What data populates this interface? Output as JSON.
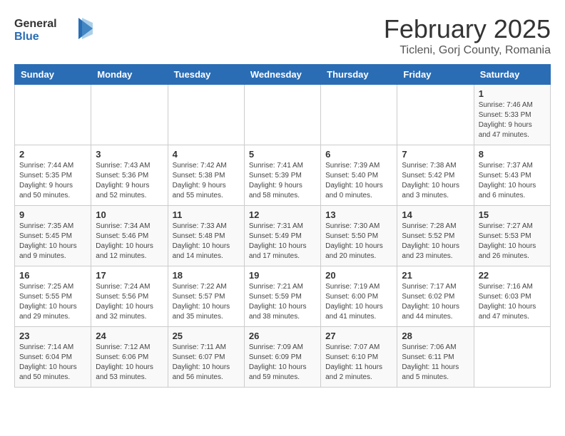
{
  "logo": {
    "general": "General",
    "blue": "Blue"
  },
  "title": "February 2025",
  "subtitle": "Ticleni, Gorj County, Romania",
  "weekdays": [
    "Sunday",
    "Monday",
    "Tuesday",
    "Wednesday",
    "Thursday",
    "Friday",
    "Saturday"
  ],
  "weeks": [
    [
      {
        "day": "",
        "info": ""
      },
      {
        "day": "",
        "info": ""
      },
      {
        "day": "",
        "info": ""
      },
      {
        "day": "",
        "info": ""
      },
      {
        "day": "",
        "info": ""
      },
      {
        "day": "",
        "info": ""
      },
      {
        "day": "1",
        "info": "Sunrise: 7:46 AM\nSunset: 5:33 PM\nDaylight: 9 hours and 47 minutes."
      }
    ],
    [
      {
        "day": "2",
        "info": "Sunrise: 7:44 AM\nSunset: 5:35 PM\nDaylight: 9 hours and 50 minutes."
      },
      {
        "day": "3",
        "info": "Sunrise: 7:43 AM\nSunset: 5:36 PM\nDaylight: 9 hours and 52 minutes."
      },
      {
        "day": "4",
        "info": "Sunrise: 7:42 AM\nSunset: 5:38 PM\nDaylight: 9 hours and 55 minutes."
      },
      {
        "day": "5",
        "info": "Sunrise: 7:41 AM\nSunset: 5:39 PM\nDaylight: 9 hours and 58 minutes."
      },
      {
        "day": "6",
        "info": "Sunrise: 7:39 AM\nSunset: 5:40 PM\nDaylight: 10 hours and 0 minutes."
      },
      {
        "day": "7",
        "info": "Sunrise: 7:38 AM\nSunset: 5:42 PM\nDaylight: 10 hours and 3 minutes."
      },
      {
        "day": "8",
        "info": "Sunrise: 7:37 AM\nSunset: 5:43 PM\nDaylight: 10 hours and 6 minutes."
      }
    ],
    [
      {
        "day": "9",
        "info": "Sunrise: 7:35 AM\nSunset: 5:45 PM\nDaylight: 10 hours and 9 minutes."
      },
      {
        "day": "10",
        "info": "Sunrise: 7:34 AM\nSunset: 5:46 PM\nDaylight: 10 hours and 12 minutes."
      },
      {
        "day": "11",
        "info": "Sunrise: 7:33 AM\nSunset: 5:48 PM\nDaylight: 10 hours and 14 minutes."
      },
      {
        "day": "12",
        "info": "Sunrise: 7:31 AM\nSunset: 5:49 PM\nDaylight: 10 hours and 17 minutes."
      },
      {
        "day": "13",
        "info": "Sunrise: 7:30 AM\nSunset: 5:50 PM\nDaylight: 10 hours and 20 minutes."
      },
      {
        "day": "14",
        "info": "Sunrise: 7:28 AM\nSunset: 5:52 PM\nDaylight: 10 hours and 23 minutes."
      },
      {
        "day": "15",
        "info": "Sunrise: 7:27 AM\nSunset: 5:53 PM\nDaylight: 10 hours and 26 minutes."
      }
    ],
    [
      {
        "day": "16",
        "info": "Sunrise: 7:25 AM\nSunset: 5:55 PM\nDaylight: 10 hours and 29 minutes."
      },
      {
        "day": "17",
        "info": "Sunrise: 7:24 AM\nSunset: 5:56 PM\nDaylight: 10 hours and 32 minutes."
      },
      {
        "day": "18",
        "info": "Sunrise: 7:22 AM\nSunset: 5:57 PM\nDaylight: 10 hours and 35 minutes."
      },
      {
        "day": "19",
        "info": "Sunrise: 7:21 AM\nSunset: 5:59 PM\nDaylight: 10 hours and 38 minutes."
      },
      {
        "day": "20",
        "info": "Sunrise: 7:19 AM\nSunset: 6:00 PM\nDaylight: 10 hours and 41 minutes."
      },
      {
        "day": "21",
        "info": "Sunrise: 7:17 AM\nSunset: 6:02 PM\nDaylight: 10 hours and 44 minutes."
      },
      {
        "day": "22",
        "info": "Sunrise: 7:16 AM\nSunset: 6:03 PM\nDaylight: 10 hours and 47 minutes."
      }
    ],
    [
      {
        "day": "23",
        "info": "Sunrise: 7:14 AM\nSunset: 6:04 PM\nDaylight: 10 hours and 50 minutes."
      },
      {
        "day": "24",
        "info": "Sunrise: 7:12 AM\nSunset: 6:06 PM\nDaylight: 10 hours and 53 minutes."
      },
      {
        "day": "25",
        "info": "Sunrise: 7:11 AM\nSunset: 6:07 PM\nDaylight: 10 hours and 56 minutes."
      },
      {
        "day": "26",
        "info": "Sunrise: 7:09 AM\nSunset: 6:09 PM\nDaylight: 10 hours and 59 minutes."
      },
      {
        "day": "27",
        "info": "Sunrise: 7:07 AM\nSunset: 6:10 PM\nDaylight: 11 hours and 2 minutes."
      },
      {
        "day": "28",
        "info": "Sunrise: 7:06 AM\nSunset: 6:11 PM\nDaylight: 11 hours and 5 minutes."
      },
      {
        "day": "",
        "info": ""
      }
    ]
  ]
}
